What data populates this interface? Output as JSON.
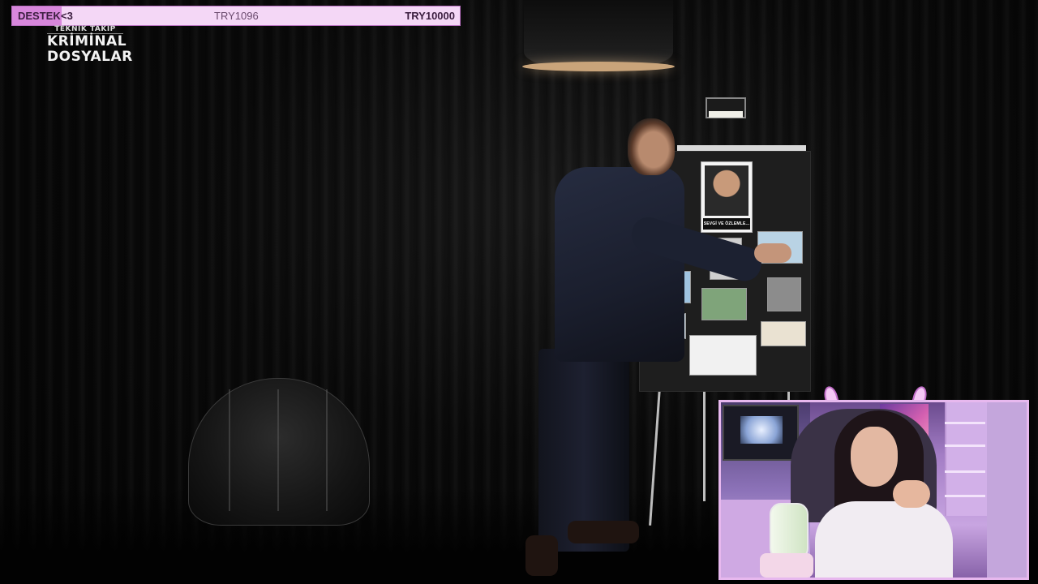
{
  "goal": {
    "label": "DESTEK",
    "heart": "<3",
    "current": "TRY1096",
    "target": "TRY10000",
    "progress_fraction": 0.11,
    "colors": {
      "bar_bg": "#f4d7f6",
      "bar_fill": "#d887dc",
      "border": "#b86fc0"
    }
  },
  "logo": {
    "line1": "TEKNİK TAKİP",
    "line2": "KRİMİNAL",
    "line3": "DOSYALAR"
  },
  "board": {
    "portrait_caption": "SEVGİ VE ÖZLEMLE..."
  },
  "webcam": {
    "frame_color": "#e7b8ee",
    "decoration": "devil-horns"
  }
}
